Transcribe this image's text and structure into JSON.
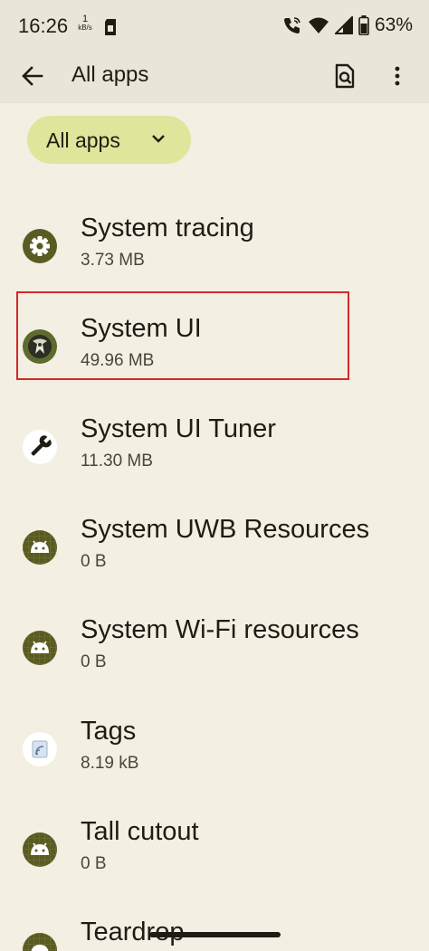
{
  "status_bar": {
    "time": "16:26",
    "speed_value": "1",
    "speed_unit": "kB/s",
    "battery": "63%"
  },
  "app_bar": {
    "title": "All apps"
  },
  "filter": {
    "label": "All apps"
  },
  "apps": [
    {
      "name": "System tracing",
      "size": "3.73 MB",
      "icon": "gear-icon"
    },
    {
      "name": "System UI",
      "size": "49.96 MB",
      "icon": "system-ui-icon"
    },
    {
      "name": "System UI Tuner",
      "size": "11.30 MB",
      "icon": "wrench-icon"
    },
    {
      "name": "System UWB Resources",
      "size": "0 B",
      "icon": "android-icon"
    },
    {
      "name": "System Wi-Fi resources",
      "size": "0 B",
      "icon": "android-icon"
    },
    {
      "name": "Tags",
      "size": "8.19 kB",
      "icon": "nfc-tags-icon"
    },
    {
      "name": "Tall cutout",
      "size": "0 B",
      "icon": "android-icon"
    },
    {
      "name": "Teardrop",
      "size": "",
      "icon": "android-icon"
    }
  ],
  "colors": {
    "background": "#f3efe3",
    "app_bar": "#e9e6d9",
    "chip": "#dfe59a",
    "icon_olive": "#5a5b22",
    "highlight": "#d7262b"
  }
}
